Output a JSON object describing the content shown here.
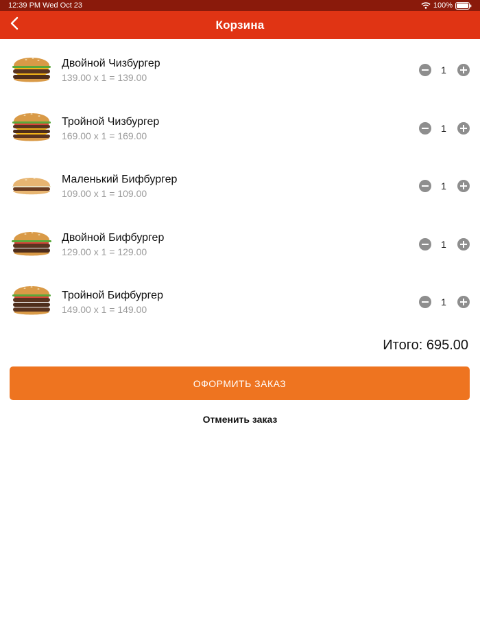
{
  "status_bar": {
    "time": "12:39 PM",
    "date": "Wed Oct 23",
    "battery": "100%",
    "icons": [
      "wifi-icon",
      "battery-icon"
    ]
  },
  "header": {
    "title": "Корзина",
    "back_icon": "chevron-left-icon"
  },
  "colors": {
    "status_bar": "#8a1a0b",
    "nav_bar": "#e03414",
    "checkout_button": "#ee7420",
    "qty_button": "#8e8e8e",
    "price_text": "#9a9a9a"
  },
  "cart": {
    "items": [
      {
        "name": "Двойной Чизбургер",
        "price_line": "139.00 x 1 = 139.00",
        "quantity": "1",
        "image": "double-cheeseburger-image"
      },
      {
        "name": "Тройной Чизбургер",
        "price_line": "169.00 x 1 = 169.00",
        "quantity": "1",
        "image": "triple-cheeseburger-image"
      },
      {
        "name": "Маленький Бифбургер",
        "price_line": "109.00 x 1 = 109.00",
        "quantity": "1",
        "image": "small-beefburger-image"
      },
      {
        "name": "Двойной Бифбургер",
        "price_line": "129.00 x 1 = 129.00",
        "quantity": "1",
        "image": "double-beefburger-image"
      },
      {
        "name": "Тройной Бифбургер",
        "price_line": "149.00 x 1 = 149.00",
        "quantity": "1",
        "image": "triple-beefburger-image"
      }
    ],
    "total": "Итого: 695.00",
    "checkout_label": "ОФОРМИТЬ ЗАКАЗ",
    "cancel_label": "Отменить заказ"
  }
}
